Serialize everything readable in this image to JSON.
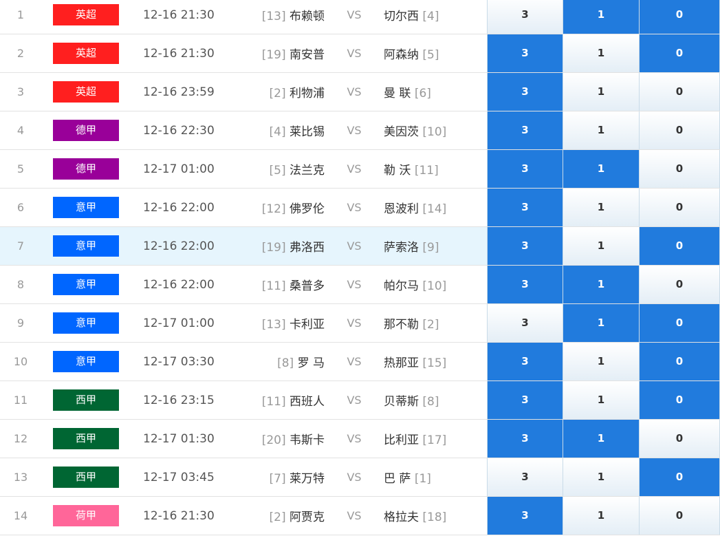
{
  "colors": {
    "英超": "#ff1f1f",
    "德甲": "#990099",
    "意甲": "#0066ff",
    "西甲": "#006633",
    "荷甲": "#ff6699",
    "selected": "#217bdd"
  },
  "matches": [
    {
      "no": "1",
      "league": "英超",
      "time": "12-16 21:30",
      "home_rank": "[13]",
      "home": "布赖顿",
      "vs": "VS",
      "away": "切尔西",
      "away_rank": "[4]",
      "odds": [
        "3",
        "1",
        "0"
      ],
      "sel": [
        false,
        true,
        true
      ]
    },
    {
      "no": "2",
      "league": "英超",
      "time": "12-16 21:30",
      "home_rank": "[19]",
      "home": "南安普",
      "vs": "VS",
      "away": "阿森纳",
      "away_rank": "[5]",
      "odds": [
        "3",
        "1",
        "0"
      ],
      "sel": [
        true,
        false,
        true
      ]
    },
    {
      "no": "3",
      "league": "英超",
      "time": "12-16 23:59",
      "home_rank": "[2]",
      "home": "利物浦",
      "vs": "VS",
      "away": "曼 联",
      "away_rank": "[6]",
      "odds": [
        "3",
        "1",
        "0"
      ],
      "sel": [
        true,
        false,
        false
      ]
    },
    {
      "no": "4",
      "league": "德甲",
      "time": "12-16 22:30",
      "home_rank": "[4]",
      "home": "莱比锡",
      "vs": "VS",
      "away": "美因茨",
      "away_rank": "[10]",
      "odds": [
        "3",
        "1",
        "0"
      ],
      "sel": [
        true,
        false,
        false
      ]
    },
    {
      "no": "5",
      "league": "德甲",
      "time": "12-17 01:00",
      "home_rank": "[5]",
      "home": "法兰克",
      "vs": "VS",
      "away": "勒 沃",
      "away_rank": "[11]",
      "odds": [
        "3",
        "1",
        "0"
      ],
      "sel": [
        true,
        true,
        false
      ]
    },
    {
      "no": "6",
      "league": "意甲",
      "time": "12-16 22:00",
      "home_rank": "[12]",
      "home": "佛罗伦",
      "vs": "VS",
      "away": "恩波利",
      "away_rank": "[14]",
      "odds": [
        "3",
        "1",
        "0"
      ],
      "sel": [
        true,
        false,
        false
      ]
    },
    {
      "no": "7",
      "league": "意甲",
      "time": "12-16 22:00",
      "home_rank": "[19]",
      "home": "弗洛西",
      "vs": "VS",
      "away": "萨索洛",
      "away_rank": "[9]",
      "odds": [
        "3",
        "1",
        "0"
      ],
      "sel": [
        true,
        false,
        true
      ],
      "hl": true
    },
    {
      "no": "8",
      "league": "意甲",
      "time": "12-16 22:00",
      "home_rank": "[11]",
      "home": "桑普多",
      "vs": "VS",
      "away": "帕尔马",
      "away_rank": "[10]",
      "odds": [
        "3",
        "1",
        "0"
      ],
      "sel": [
        true,
        true,
        false
      ]
    },
    {
      "no": "9",
      "league": "意甲",
      "time": "12-17 01:00",
      "home_rank": "[13]",
      "home": "卡利亚",
      "vs": "VS",
      "away": "那不勒",
      "away_rank": "[2]",
      "odds": [
        "3",
        "1",
        "0"
      ],
      "sel": [
        false,
        true,
        true
      ]
    },
    {
      "no": "10",
      "league": "意甲",
      "time": "12-17 03:30",
      "home_rank": "[8]",
      "home": "罗 马",
      "vs": "VS",
      "away": "热那亚",
      "away_rank": "[15]",
      "odds": [
        "3",
        "1",
        "0"
      ],
      "sel": [
        true,
        false,
        true
      ]
    },
    {
      "no": "11",
      "league": "西甲",
      "time": "12-16 23:15",
      "home_rank": "[11]",
      "home": "西班人",
      "vs": "VS",
      "away": "贝蒂斯",
      "away_rank": "[8]",
      "odds": [
        "3",
        "1",
        "0"
      ],
      "sel": [
        true,
        false,
        true
      ]
    },
    {
      "no": "12",
      "league": "西甲",
      "time": "12-17 01:30",
      "home_rank": "[20]",
      "home": "韦斯卡",
      "vs": "VS",
      "away": "比利亚",
      "away_rank": "[17]",
      "odds": [
        "3",
        "1",
        "0"
      ],
      "sel": [
        true,
        true,
        false
      ]
    },
    {
      "no": "13",
      "league": "西甲",
      "time": "12-17 03:45",
      "home_rank": "[7]",
      "home": "莱万特",
      "vs": "VS",
      "away": "巴 萨",
      "away_rank": "[1]",
      "odds": [
        "3",
        "1",
        "0"
      ],
      "sel": [
        false,
        false,
        true
      ]
    },
    {
      "no": "14",
      "league": "荷甲",
      "time": "12-16 21:30",
      "home_rank": "[2]",
      "home": "阿贾克",
      "vs": "VS",
      "away": "格拉夫",
      "away_rank": "[18]",
      "odds": [
        "3",
        "1",
        "0"
      ],
      "sel": [
        true,
        false,
        false
      ]
    }
  ]
}
